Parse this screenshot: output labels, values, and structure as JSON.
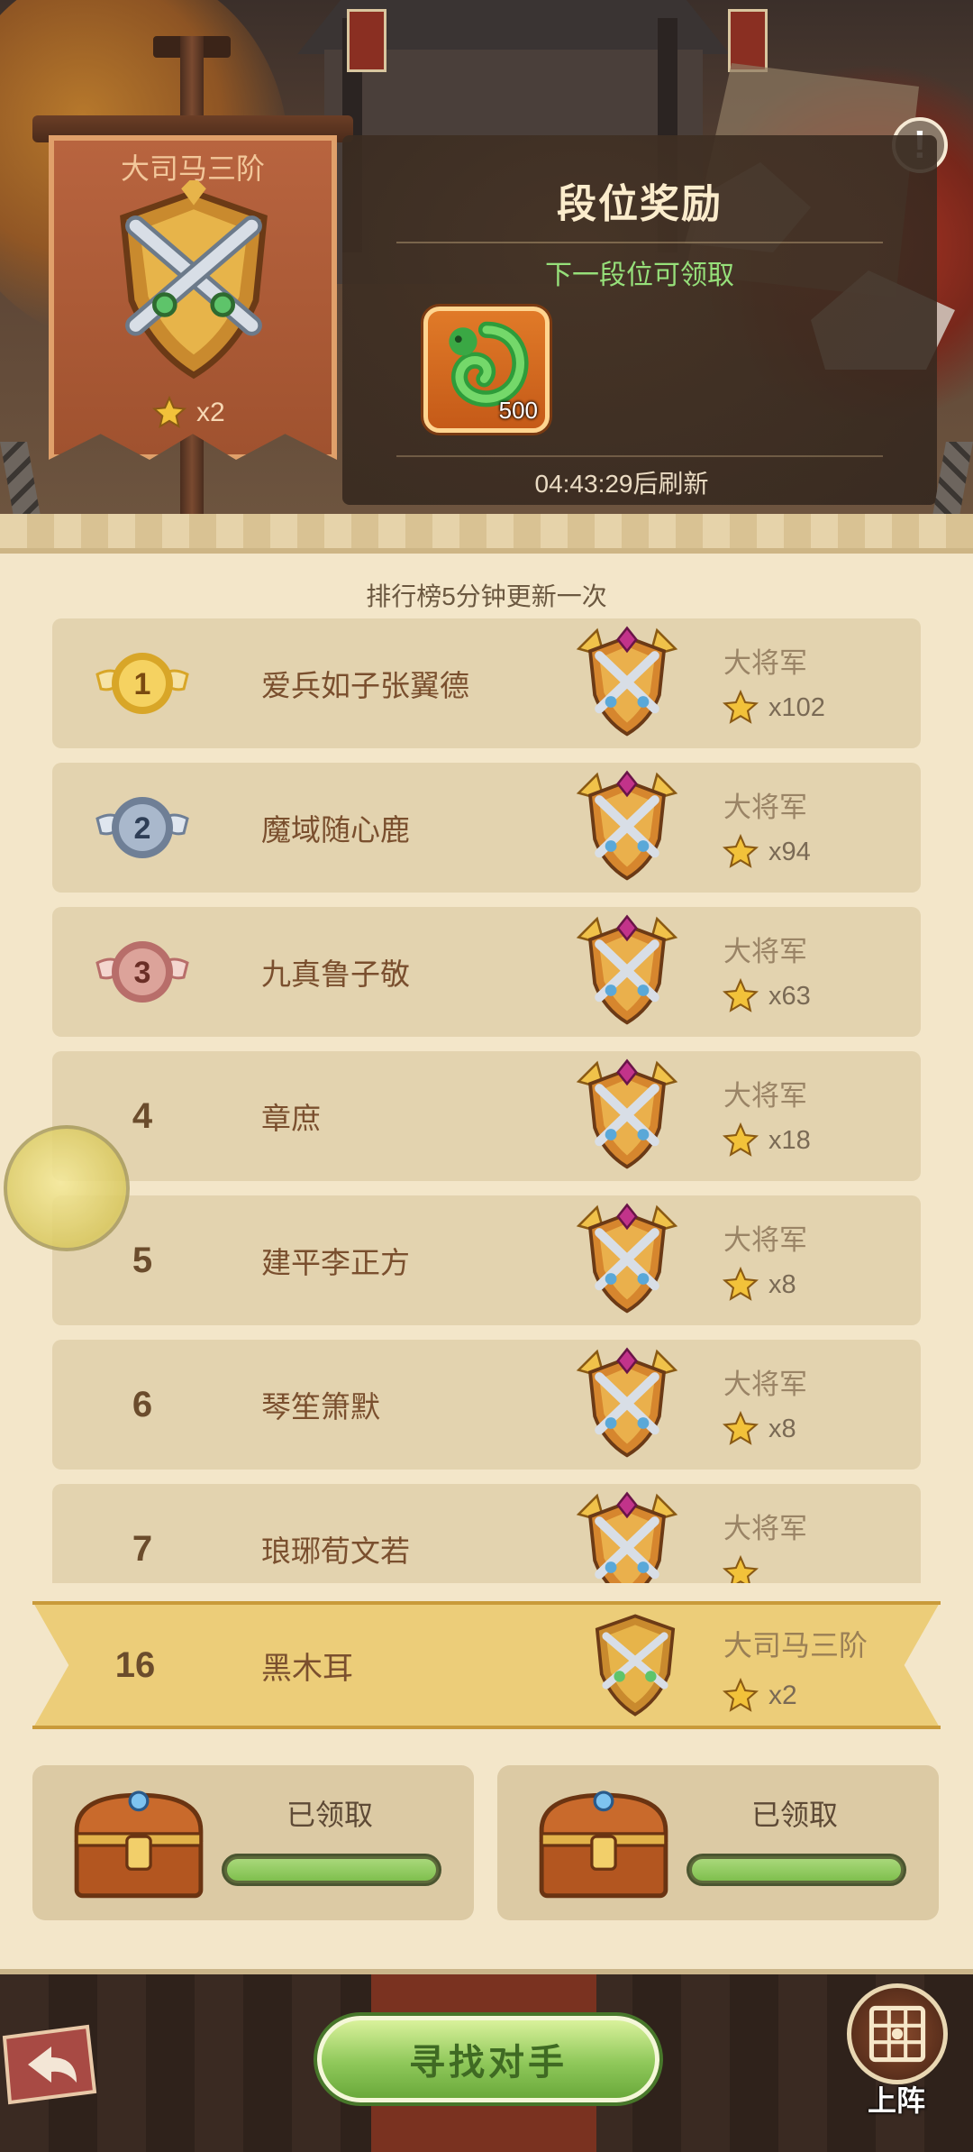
{
  "header": {
    "player_rank_title": "大司马三阶",
    "player_star_count": "x2",
    "alert_symbol": "!"
  },
  "reward_panel": {
    "title": "段位奖励",
    "subtitle": "下一段位可领取",
    "item_quantity": "500",
    "refresh_text": "04:43:29后刷新"
  },
  "leaderboard": {
    "update_note": "排行榜5分钟更新一次",
    "rows": [
      {
        "rank": "1",
        "name": "爱兵如子张翼德",
        "title": "大将军",
        "stars": "x102",
        "medal": "gold"
      },
      {
        "rank": "2",
        "name": "魔域随心鹿",
        "title": "大将军",
        "stars": "x94",
        "medal": "silver"
      },
      {
        "rank": "3",
        "name": "九真鲁子敬",
        "title": "大将军",
        "stars": "x63",
        "medal": "bronze"
      },
      {
        "rank": "4",
        "name": "章庶",
        "title": "大将军",
        "stars": "x18"
      },
      {
        "rank": "5",
        "name": "建平李正方",
        "title": "大将军",
        "stars": "x8"
      },
      {
        "rank": "6",
        "name": "琴笙箫默",
        "title": "大将军",
        "stars": "x8"
      },
      {
        "rank": "7",
        "name": "琅琊荀文若",
        "title": "大将军",
        "stars": ""
      }
    ],
    "my_row": {
      "rank": "16",
      "name": "黑木耳",
      "title": "大司马三阶",
      "stars": "x2"
    }
  },
  "chests": [
    {
      "label": "已领取",
      "progress": 1.0
    },
    {
      "label": "已领取",
      "progress": 1.0
    }
  ],
  "bottom_bar": {
    "find_opponent": "寻找对手",
    "deploy": "上阵"
  },
  "icons": {
    "back": "back-arrow-icon",
    "deploy": "formation-grid-icon",
    "alert": "exclamation-icon",
    "reward": "jade-dragon-ring-icon",
    "star": "star-icon",
    "chest": "treasure-chest-icon"
  },
  "colors": {
    "parchment": "#f3e6c9",
    "row_bg": "#e3d3af",
    "highlight_row": "#eccd79",
    "reward_green_text": "#96e07a",
    "progress_fill": "#7fbf4e",
    "button_green": "#8fc85a"
  }
}
